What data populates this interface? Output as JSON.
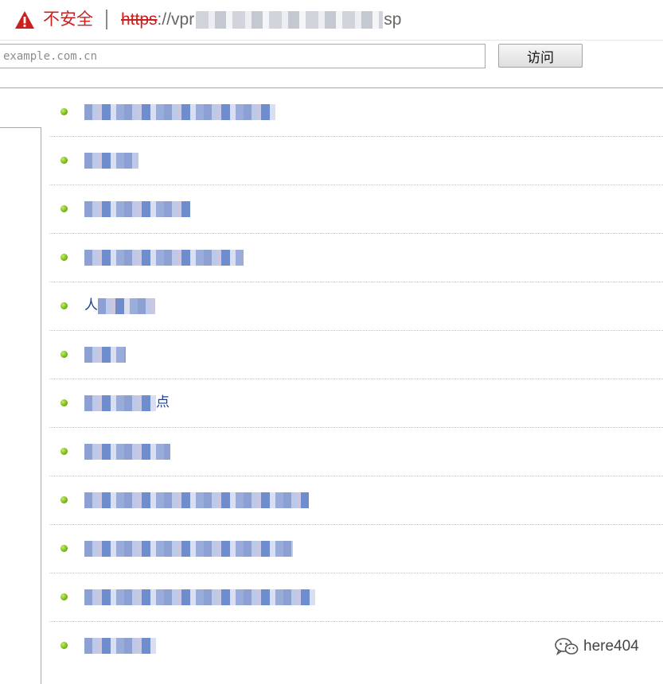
{
  "address_bar": {
    "security_label": "不安全",
    "url_scheme": "https",
    "url_separator": "://",
    "url_visible_start": "vpr",
    "url_visible_end": "sp",
    "warning_color": "#cc1f1f"
  },
  "visit_form": {
    "input_placeholder": "example.com.cn",
    "input_value": "",
    "button_label": "访问"
  },
  "link_list": {
    "bullet_color": "#7bbb1c",
    "items": [
      {
        "visible_text": ""
      },
      {
        "visible_text": ""
      },
      {
        "visible_text": ""
      },
      {
        "visible_text": ""
      },
      {
        "visible_text": "人"
      },
      {
        "visible_text": ""
      },
      {
        "visible_text": "点"
      },
      {
        "visible_text": ""
      },
      {
        "visible_text": ""
      },
      {
        "visible_text": ""
      },
      {
        "visible_text": ""
      },
      {
        "visible_text": ""
      }
    ]
  },
  "watermark": {
    "icon": "wechat-icon",
    "text": "here404"
  }
}
